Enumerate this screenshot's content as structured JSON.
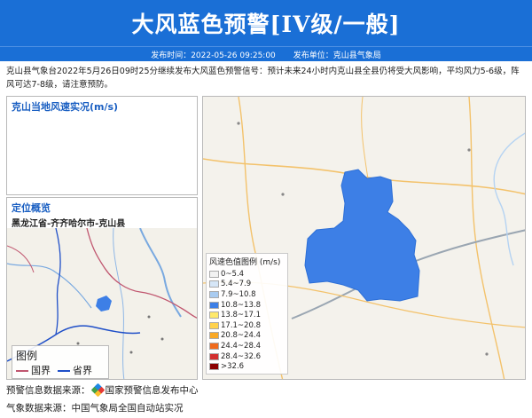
{
  "header": {
    "title": "大风蓝色预警[IV级/一般]",
    "publish_time": "发布时间：2022-05-26 09:25:00",
    "publisher": "发布单位：克山县气象局"
  },
  "description": "克山县气象台2022年5月26日09时25分继续发布大风蓝色预警信号：预计未来24小时内克山县全县仍将受大风影响，平均风力5-6级，阵风可达7-8级，请注意预防。",
  "wind_panel": {
    "title": "克山当地风速实况(m/s)"
  },
  "location_panel": {
    "title": "定位概览",
    "region": "黑龙江省-齐齐哈尔市-克山县",
    "legend": {
      "title": "图例",
      "items": [
        {
          "label": "国界",
          "color": "#c0566f"
        },
        {
          "label": "省界",
          "color": "#1f4fc8"
        }
      ]
    }
  },
  "map": {
    "region_color": "#3d7fe6",
    "legend": {
      "title": "风速色值图例 (m/s)",
      "ranges": [
        {
          "label": "0~5.4",
          "color": "#f2f2f2"
        },
        {
          "label": "5.4~7.9",
          "color": "#d6e6f7"
        },
        {
          "label": "7.9~10.8",
          "color": "#a9cbf0"
        },
        {
          "label": "10.8~13.8",
          "color": "#3d7fe6"
        },
        {
          "label": "13.8~17.1",
          "color": "#ffe96b"
        },
        {
          "label": "17.1~20.8",
          "color": "#ffd24d"
        },
        {
          "label": "20.8~24.4",
          "color": "#f9a825"
        },
        {
          "label": "24.4~28.4",
          "color": "#f06a1c"
        },
        {
          "label": "28.4~32.6",
          "color": "#d32f2f"
        },
        {
          "label": ">32.6",
          "color": "#8b0000"
        }
      ]
    }
  },
  "footer": {
    "warning_source_label": "预警信息数据来源：",
    "warning_source_name": "国家预警信息发布中心",
    "weather_source": "气象数据来源：中国气象局全国自动站实况"
  }
}
